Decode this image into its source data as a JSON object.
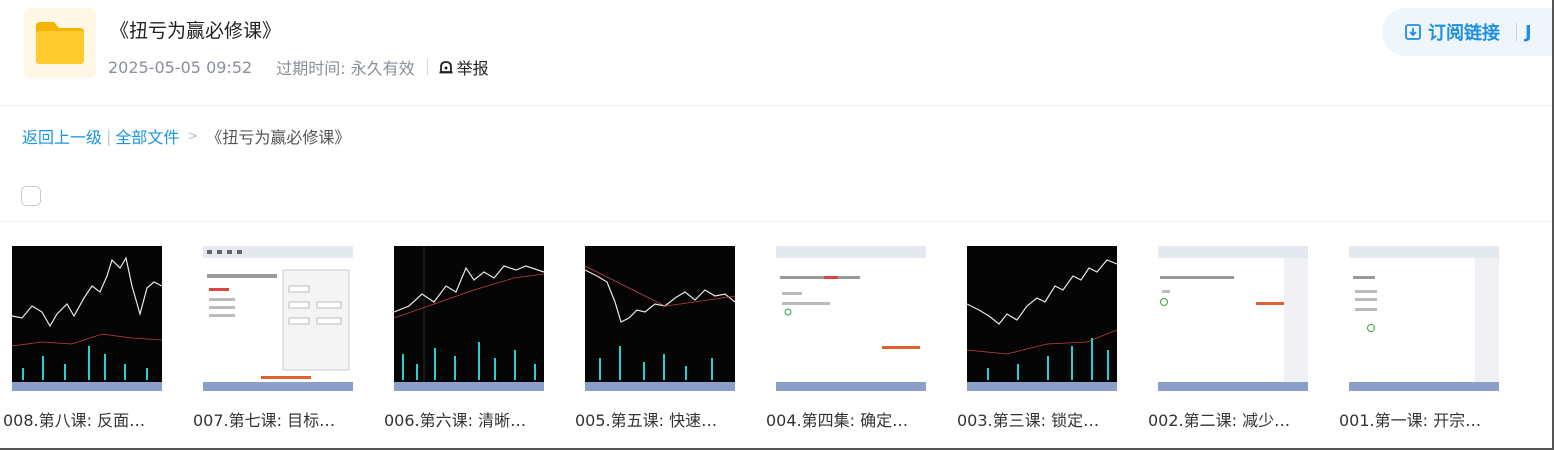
{
  "folder": {
    "title": "《扭亏为赢必修课》",
    "date": "2025-05-05 09:52",
    "expire_label": "过期时间: 永久有效",
    "report_label": "举报",
    "icon": "folder-icon"
  },
  "actions": {
    "subscribe_label": "订阅链接",
    "accent_color": "#1e8fe0"
  },
  "breadcrumb": {
    "back": "返回上一级",
    "all_files": "全部文件",
    "separator": ">",
    "current": "《扭亏为赢必修课》"
  },
  "files": [
    {
      "name": "008.第八课: 反面…",
      "thumb": "dark-chart"
    },
    {
      "name": "007.第七课: 目标…",
      "thumb": "software-window"
    },
    {
      "name": "006.第六课: 清晰…",
      "thumb": "dark-chart"
    },
    {
      "name": "005.第五课: 快速…",
      "thumb": "dark-chart"
    },
    {
      "name": "004.第四集: 确定…",
      "thumb": "white-slide"
    },
    {
      "name": "003.第三课: 锁定…",
      "thumb": "dark-chart"
    },
    {
      "name": "002.第二课: 减少…",
      "thumb": "white-slide"
    },
    {
      "name": "001.第一课: 开宗…",
      "thumb": "white-slide"
    }
  ]
}
